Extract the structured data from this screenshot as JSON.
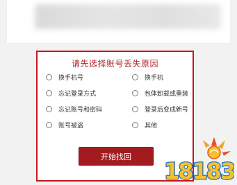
{
  "reason": {
    "title": "请先选择账号丢失原因",
    "options": [
      {
        "label": "换手机号"
      },
      {
        "label": "换手机"
      },
      {
        "label": "忘记登录方式"
      },
      {
        "label": "包体卸载或重装"
      },
      {
        "label": "忘记账号和密码"
      },
      {
        "label": "登录后变成新号"
      },
      {
        "label": "账号被盗"
      },
      {
        "label": "其他"
      }
    ],
    "submit_label": "开始找回"
  },
  "watermark": {
    "text": "18183"
  },
  "colors": {
    "accent": "#c8161d",
    "button": "#a31b1e",
    "watermark_fill": "#f6c12b",
    "watermark_outline": "#1e6fc8"
  }
}
